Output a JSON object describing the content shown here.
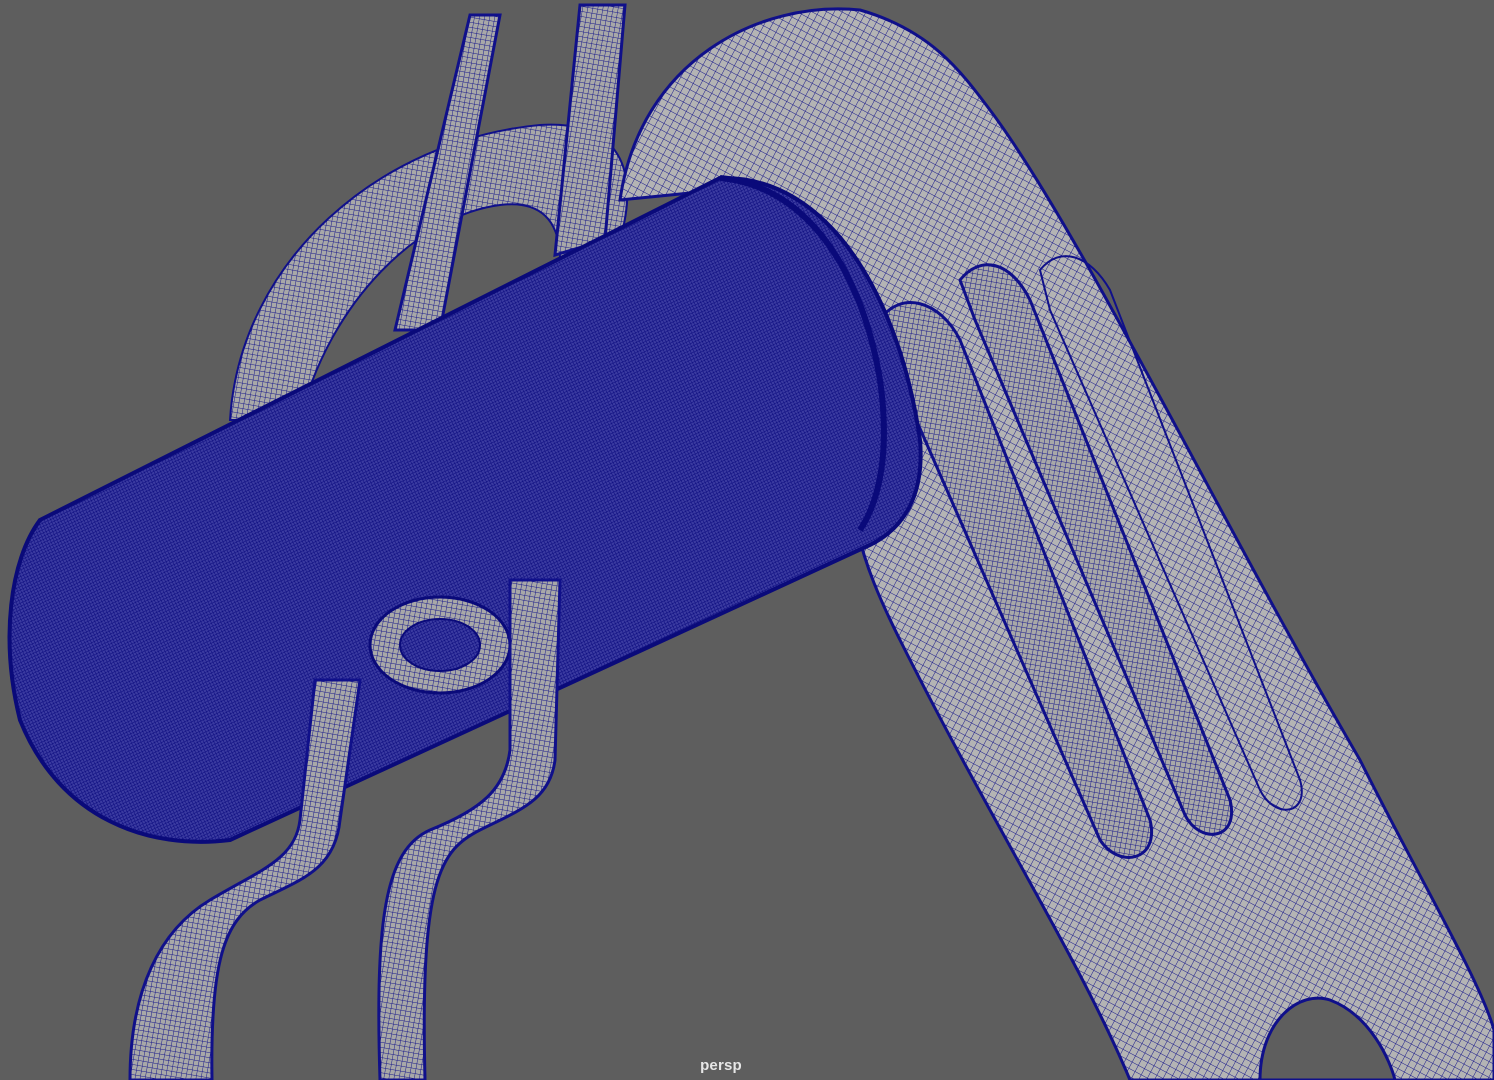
{
  "viewport": {
    "camera_label": "persp",
    "background_color": "#5e5e5e",
    "wireframe_color": "#0d0d8a",
    "surface_color": "#b4b4b4",
    "display_mode": "wireframe-on-shaded"
  }
}
